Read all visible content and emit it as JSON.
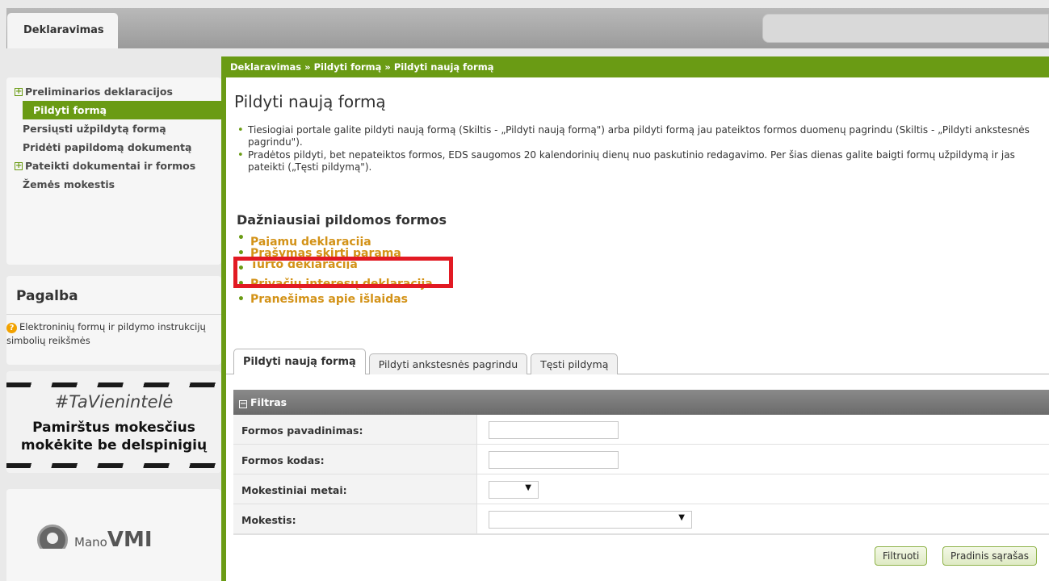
{
  "top": {
    "tab_label": "Deklaravimas"
  },
  "sidebar": {
    "items": [
      {
        "label": "Preliminarios deklaracijos",
        "plus": true
      },
      {
        "label": "Pildyti formą",
        "active": true
      },
      {
        "label": "Persiųsti užpildytą formą"
      },
      {
        "label": "Pridėti papildomą dokumentą"
      },
      {
        "label": "Pateikti dokumentai ir formos",
        "plus": true
      },
      {
        "label": "Žemės mokestis"
      }
    ],
    "help_title": "Pagalba",
    "help_text": "Elektroninių formų ir pildymo instrukcijų simbolių reikšmės",
    "banner": {
      "tag": "#TaVienintelė",
      "line1": "Pamirštus mokesčius",
      "line2": "mokėkite be delspinigių"
    },
    "mano": {
      "small": "Mano",
      "big": "VMI"
    }
  },
  "main": {
    "breadcrumb": "Deklaravimas » Pildyti formą » Pildyti naują formą",
    "title": "Pildyti naują formą",
    "info": [
      "Tiesiogiai portale galite pildyti naują formą (Skiltis - „Pildyti naują formą\") arba pildyti formą jau pateiktos formos duomenų pagrindu (Skiltis - „Pildyti ankstesnės pagrindu\").",
      "Pradėtos pildyti, bet nepateiktos formos, EDS saugomos 20 kalendorinių dienų nuo paskutinio redagavimo. Per šias dienas galite baigti formų užpildymą ir jas pateikti („Tęsti pildymą\")."
    ],
    "freq_title": "Dažniausiai pildomos formos",
    "freq_items": [
      "Pajamų deklaracija",
      "Prašymas skirti paramą",
      "Turto deklaracija",
      "Privačių interesų deklaracija",
      "Pranešimas apie išlaidas"
    ],
    "tabs": [
      "Pildyti naują formą",
      "Pildyti ankstesnės pagrindu",
      "Tęsti pildymą"
    ],
    "filter": {
      "title": "Filtras",
      "labels": {
        "name": "Formos pavadinimas:",
        "code": "Formos kodas:",
        "year": "Mokestiniai metai:",
        "tax": "Mokestis:"
      },
      "values": {
        "name": "",
        "code": "",
        "year": "",
        "tax": ""
      },
      "filter_button": "Filtruoti",
      "reset_button": "Pradinis sąrašas"
    }
  },
  "colors": {
    "accent_green": "#6a9b14",
    "link_orange": "#d39217",
    "highlight_red": "#e21a23"
  }
}
